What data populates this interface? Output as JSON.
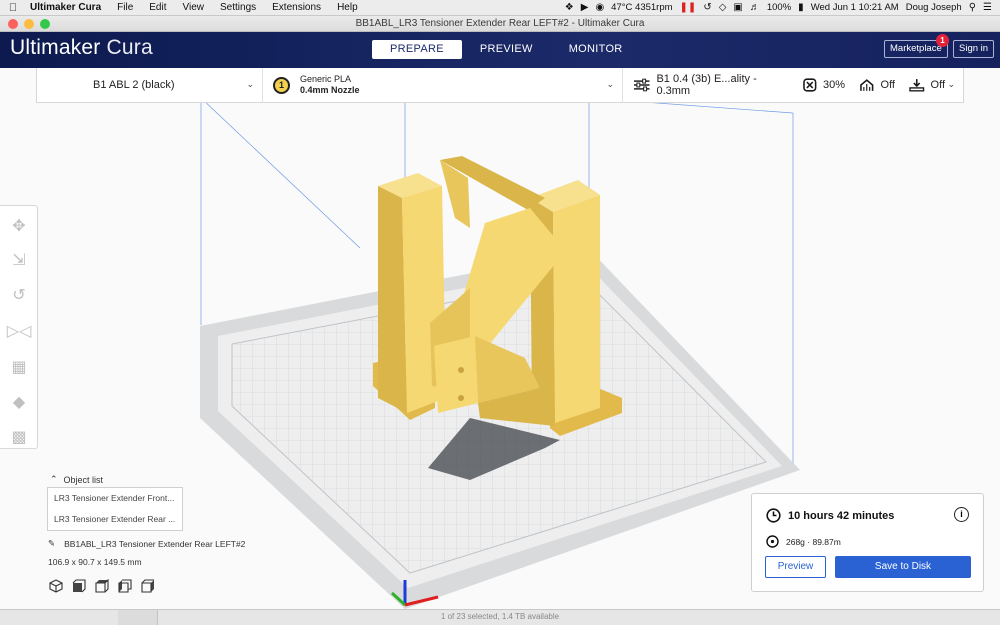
{
  "menubar": {
    "app": "Ultimaker Cura",
    "items": [
      "File",
      "Edit",
      "View",
      "Settings",
      "Extensions",
      "Help"
    ],
    "temp": "47°C 4351rpm",
    "battery": "100%",
    "clock": "Wed Jun 1  10:21 AM",
    "user": "Doug Joseph"
  },
  "window": {
    "title": "BB1ABL_LR3 Tensioner Extender Rear LEFT#2 - Ultimaker Cura"
  },
  "header": {
    "brand_main": "Ultimaker",
    "brand_thin": "Cura",
    "tabs": [
      "PREPARE",
      "PREVIEW",
      "MONITOR"
    ],
    "marketplace": "Marketplace",
    "badge": "1",
    "signin": "Sign in"
  },
  "settings_bar": {
    "printer": "B1 ABL 2 (black)",
    "material_name": "Generic PLA",
    "nozzle": "0.4mm Nozzle",
    "extruder_num": "1",
    "profile": "B1 0.4 (3b) E...ality - 0.3mm",
    "infill": "30%",
    "support": "Off",
    "adhesion": "Off"
  },
  "objects": {
    "title": "Object list",
    "rows": [
      "LR3 Tensioner Extender Front...",
      "LR3 Tensioner Extender Rear ..."
    ],
    "selected_name": "BB1ABL_LR3 Tensioner Extender Rear LEFT#2",
    "dimensions": "106.9 x 90.7 x 149.5 mm"
  },
  "print_panel": {
    "time": "10 hours 42 minutes",
    "material": "268g · 89.87m",
    "preview": "Preview",
    "save": "Save to Disk"
  },
  "finder": {
    "status": "1 of 23 selected, 1.4 TB available"
  },
  "colors": {
    "header": "#1c2a6a",
    "accent": "#2a62d4",
    "model": "#f5d872",
    "badge": "#e3223a"
  }
}
